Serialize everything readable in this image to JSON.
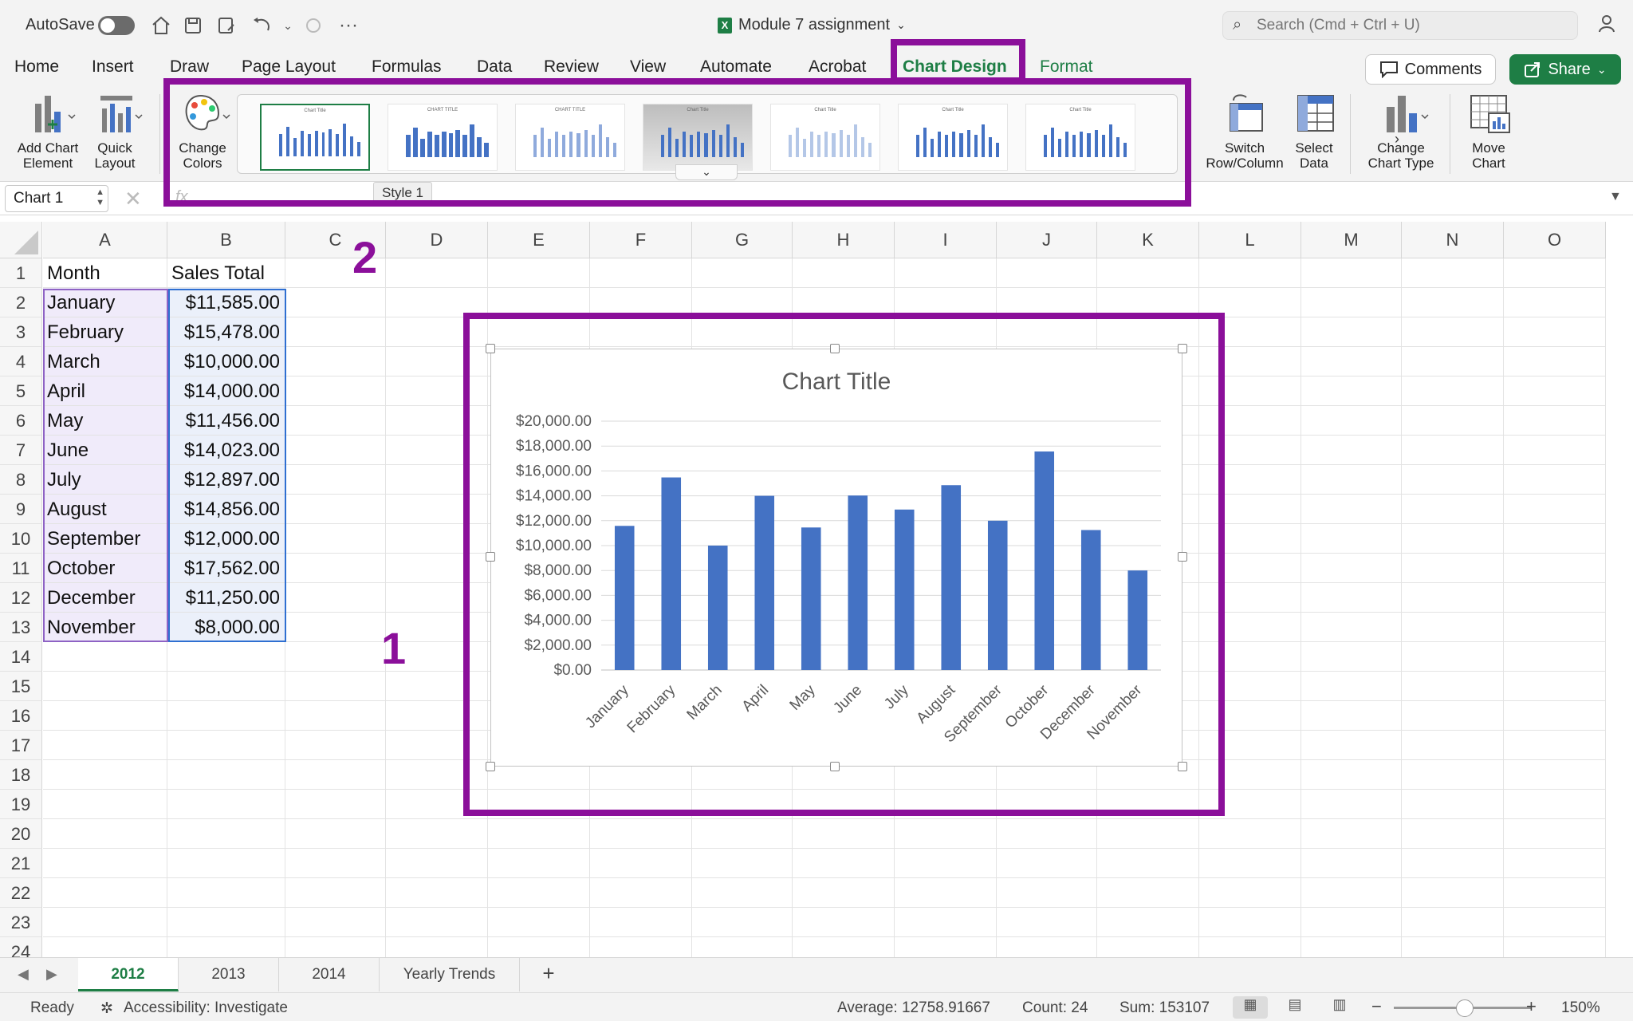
{
  "titlebar": {
    "autosave_label": "AutoSave",
    "doc_title": "Module 7 assignment",
    "search_placeholder": "Search (Cmd + Ctrl + U)"
  },
  "ribbon_tabs": [
    "Home",
    "Insert",
    "Draw",
    "Page Layout",
    "Formulas",
    "Data",
    "Review",
    "View",
    "Automate",
    "Acrobat",
    "Chart Design",
    "Format"
  ],
  "active_tab": "Chart Design",
  "buttons": {
    "comments": "Comments",
    "share": "Share"
  },
  "ribbon": {
    "add_chart_element": [
      "Add Chart",
      "Element"
    ],
    "quick_layout": [
      "Quick",
      "Layout"
    ],
    "change_colors": [
      "Change",
      "Colors"
    ],
    "switch_row_column": [
      "Switch",
      "Row/Column"
    ],
    "select_data": [
      "Select",
      "Data"
    ],
    "change_chart_type": [
      "Change",
      "Chart Type"
    ],
    "move_chart": [
      "Move",
      "Chart"
    ],
    "style_tooltip": "Style 1"
  },
  "formula_bar": {
    "name_box": "Chart 1",
    "fx": "fx"
  },
  "columns": [
    "A",
    "B",
    "C",
    "D",
    "E",
    "F",
    "G",
    "H",
    "I",
    "J",
    "K",
    "L",
    "M",
    "N",
    "O"
  ],
  "rows": [
    "1",
    "2",
    "3",
    "4",
    "5",
    "6",
    "7",
    "8",
    "9",
    "10",
    "11",
    "12",
    "13",
    "14",
    "15",
    "16",
    "17",
    "18",
    "19",
    "20",
    "21",
    "22",
    "23",
    "24"
  ],
  "sheet": {
    "header": [
      "Month",
      "Sales Total"
    ],
    "data": [
      [
        "January",
        "$11,585.00"
      ],
      [
        "February",
        "$15,478.00"
      ],
      [
        "March",
        "$10,000.00"
      ],
      [
        "April",
        "$14,000.00"
      ],
      [
        "May",
        "$11,456.00"
      ],
      [
        "June",
        "$14,023.00"
      ],
      [
        "July",
        "$12,897.00"
      ],
      [
        "August",
        "$14,856.00"
      ],
      [
        "September",
        "$12,000.00"
      ],
      [
        "October",
        "$17,562.00"
      ],
      [
        "December",
        "$11,250.00"
      ],
      [
        "November",
        "$8,000.00"
      ]
    ]
  },
  "annotations": {
    "label_1": "1",
    "label_2": "2",
    "color": "#8b0f9a"
  },
  "chart_data": {
    "type": "bar",
    "title": "Chart Title",
    "categories": [
      "January",
      "February",
      "March",
      "April",
      "May",
      "June",
      "July",
      "August",
      "September",
      "October",
      "December",
      "November"
    ],
    "values": [
      11585,
      15478,
      10000,
      14000,
      11456,
      14023,
      12897,
      14856,
      12000,
      17562,
      11250,
      8000
    ],
    "ylim": [
      0,
      20000
    ],
    "yticks": [
      "$0.00",
      "$2,000.00",
      "$4,000.00",
      "$6,000.00",
      "$8,000.00",
      "$10,000.00",
      "$12,000.00",
      "$14,000.00",
      "$16,000.00",
      "$18,000.00",
      "$20,000.00"
    ],
    "bar_color": "#4472c4",
    "grid": true
  },
  "sheet_tabs": [
    "2012",
    "2013",
    "2014",
    "Yearly Trends"
  ],
  "active_sheet": "2012",
  "status": {
    "ready": "Ready",
    "accessibility": "Accessibility: Investigate",
    "average": "Average: 12758.91667",
    "count": "Count: 24",
    "sum": "Sum: 153107",
    "zoom": "150%"
  },
  "colors": {
    "accent": "#1e7e45",
    "selection_a": "#8e62c4",
    "selection_b": "#2f6fd1"
  }
}
